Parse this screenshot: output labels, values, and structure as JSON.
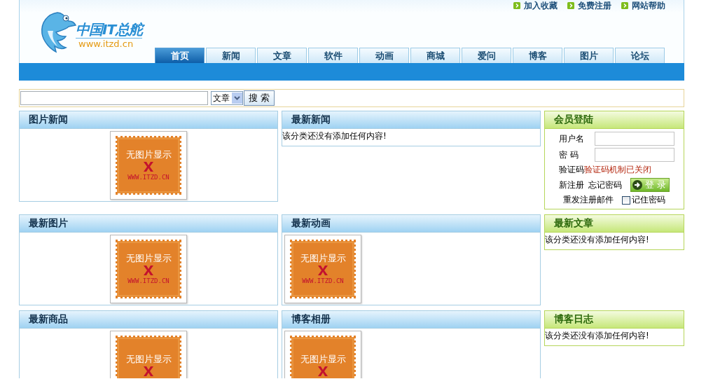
{
  "header": {
    "logo_title": "中国IT总舵",
    "logo_url": "www.itzd.cn",
    "top_links": [
      "加入收藏",
      "免费注册",
      "网站帮助"
    ],
    "tabs": [
      {
        "label": "首页",
        "selected": true
      },
      {
        "label": "新闻",
        "selected": false
      },
      {
        "label": "文章",
        "selected": false
      },
      {
        "label": "软件",
        "selected": false
      },
      {
        "label": "动画",
        "selected": false
      },
      {
        "label": "商城",
        "selected": false
      },
      {
        "label": "爱问",
        "selected": false
      },
      {
        "label": "博客",
        "selected": false
      },
      {
        "label": "图片",
        "selected": false
      },
      {
        "label": "论坛",
        "selected": false
      }
    ]
  },
  "search": {
    "category": "文章",
    "button": "搜 索"
  },
  "panels": [
    {
      "title": "图片新闻",
      "kind": "pictures",
      "images": [
        {
          "caption": "无图片显示",
          "url": "WWW.ITZD.CN"
        }
      ]
    },
    {
      "title": "最新新闻",
      "kind": "empty",
      "message": "该分类还没有添加任何内容!"
    },
    {
      "title": "会员登陆",
      "kind": "login"
    },
    {
      "title": "最新图片",
      "kind": "pictures",
      "images": [
        {
          "caption": "无图片显示",
          "url": "WWW.ITZD.CN"
        }
      ]
    },
    {
      "title": "最新动画",
      "kind": "pictures",
      "images": [
        {
          "caption": "无图片显示",
          "url": "WWW.ITZD.CN"
        }
      ]
    },
    {
      "title": "最新文章",
      "kind": "empty",
      "message": "该分类还没有添加任何内容!"
    },
    {
      "title": "最新商品",
      "kind": "pictures",
      "images": [
        {
          "caption": "无图片显示"
        }
      ]
    },
    {
      "title": "博客相册",
      "kind": "pictures",
      "images": [
        {
          "caption": "无图片显示"
        }
      ]
    },
    {
      "title": "博客日志",
      "kind": "empty",
      "message": "该分类还没有添加任何内容!"
    }
  ],
  "login": {
    "username_label": "用户名",
    "password_label": "密 码",
    "captcha_label": "验证码",
    "captcha_status": "验证码机制已关闭",
    "register_link": "新注册",
    "forgot_link": "忘记密码",
    "login_button": "登 录",
    "resend_link": "重发注册邮件",
    "remember": {
      "label": "记住密码",
      "checked": false
    }
  }
}
